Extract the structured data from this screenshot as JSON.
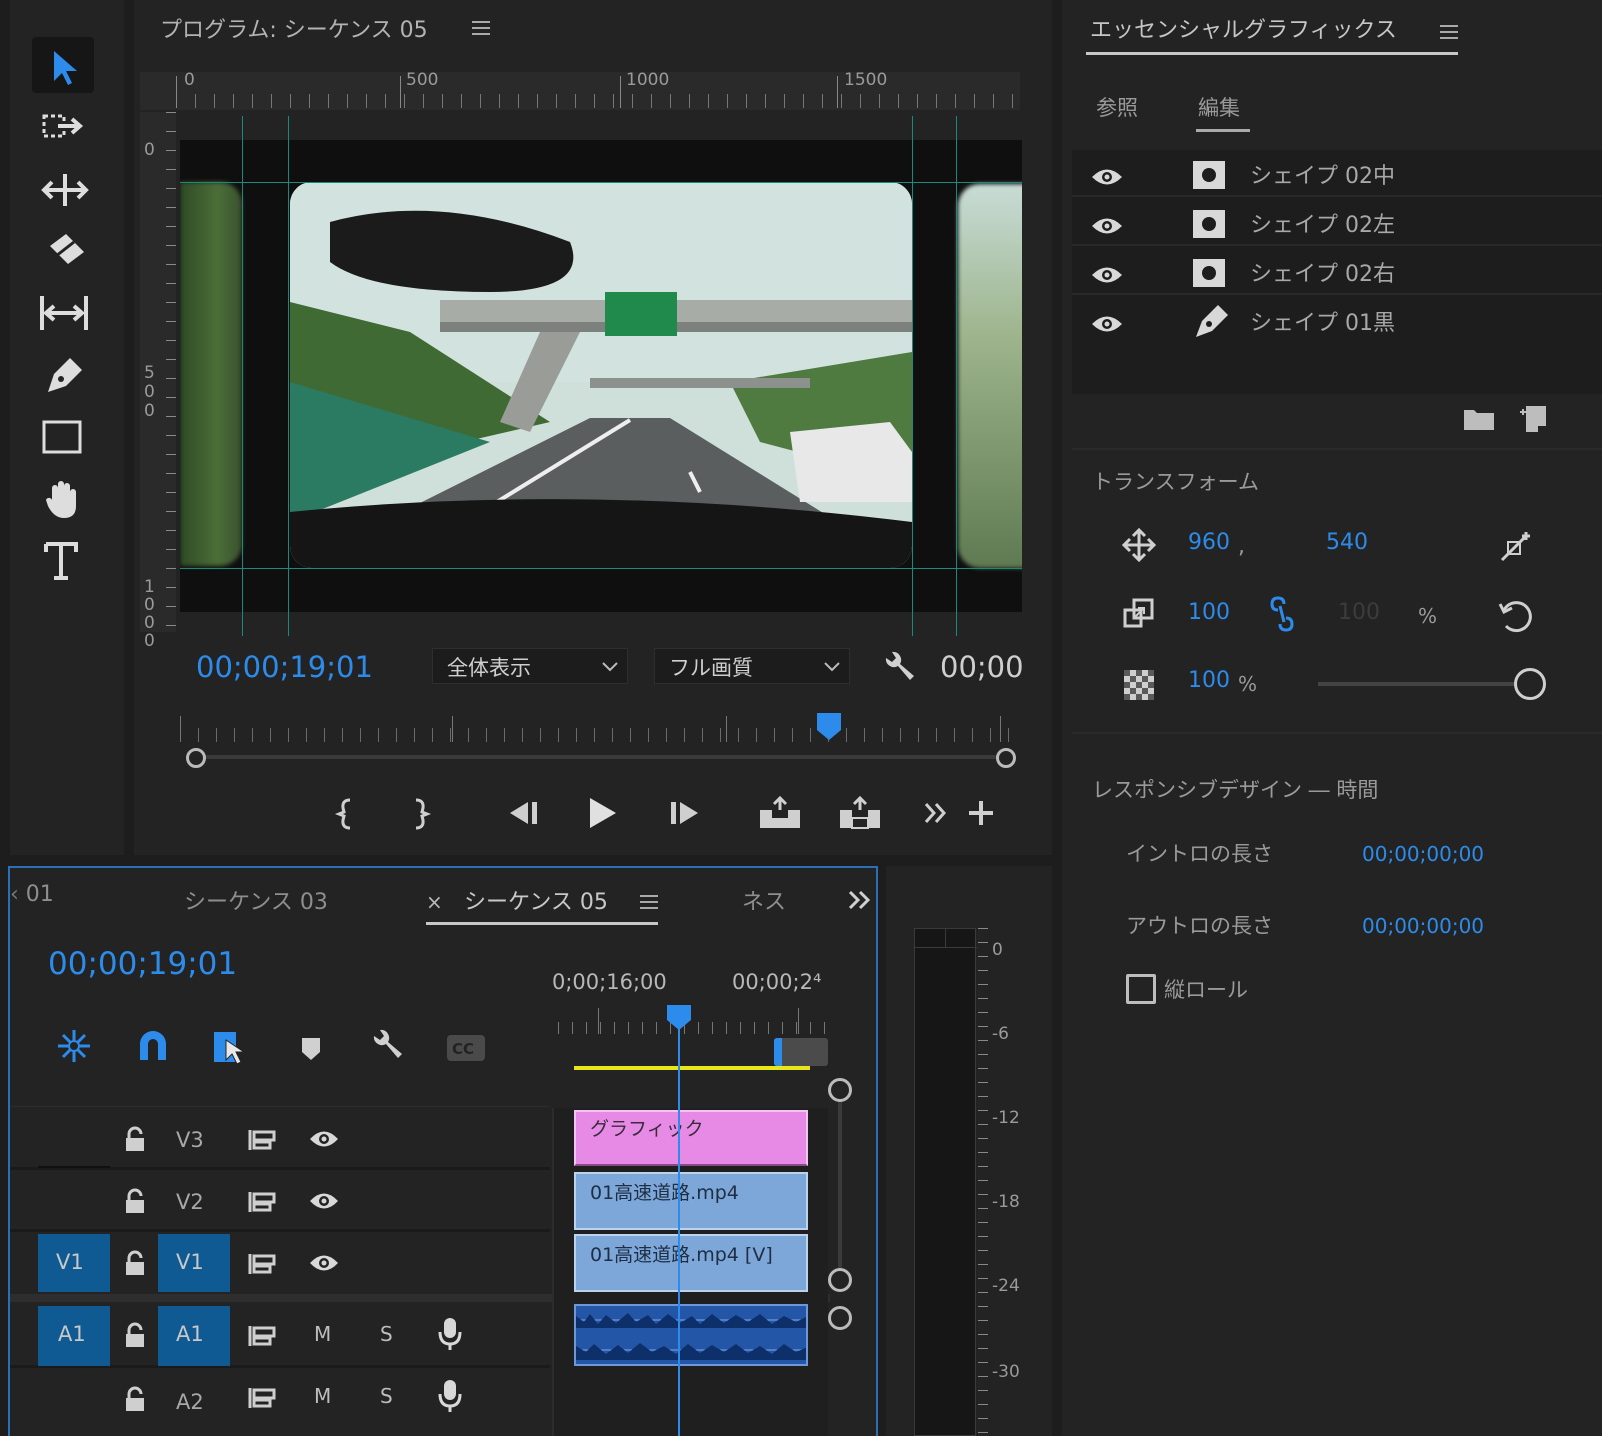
{
  "program": {
    "title": "プログラム: シーケンス 05",
    "ruler_top": [
      "0",
      "500",
      "1000",
      "1500"
    ],
    "ruler_left": [
      "0",
      "5\n0\n0",
      "1\n0\n0\n0"
    ],
    "timecode": "00;00;19;01",
    "zoom_select": "全体表示",
    "quality_select": "フル画質",
    "duration": "00;00"
  },
  "egraphics": {
    "title": "エッセンシャルグラフィックス",
    "tab_browse": "参照",
    "tab_edit": "編集",
    "layers": [
      {
        "name": "シェイプ 02中",
        "icon": "shape-icon"
      },
      {
        "name": "シェイプ 02左",
        "icon": "shape-icon"
      },
      {
        "name": "シェイプ 02右",
        "icon": "shape-icon"
      },
      {
        "name": "シェイプ 01黒",
        "icon": "pen-icon"
      }
    ],
    "transform_title": "トランスフォーム",
    "pos_x": "960",
    "pos_sep": ",",
    "pos_y": "540",
    "scale": "100",
    "scale_h": "100",
    "scale_unit": "%",
    "opacity": "100",
    "opacity_unit": "%",
    "responsive_title": "レスポンシブデザイン ― 時間",
    "intro_label": "イントロの長さ",
    "intro_value": "00;00;00;00",
    "outro_label": "アウトロの長さ",
    "outro_value": "00;00;00;00",
    "roll_label": "縦ロール"
  },
  "timeline": {
    "tabs": [
      "01",
      "シーケンス 03",
      "シーケンス 05",
      "ネス"
    ],
    "close": "×",
    "overflow": "»",
    "timecode": "00;00;19;01",
    "ruler": [
      "0;00;16;00",
      "00;00;2⁴"
    ],
    "tracks": [
      {
        "src": "",
        "lock": "lock-icon",
        "name": "V3"
      },
      {
        "src": "",
        "lock": "lock-icon",
        "name": "V2"
      },
      {
        "src": "V1",
        "lock": "lock-icon",
        "name": "V1"
      },
      {
        "src": "A1",
        "lock": "lock-icon",
        "name": "A1",
        "m": "M",
        "s": "S"
      },
      {
        "src": "",
        "lock": "lock-icon",
        "name": "A2",
        "m": "M",
        "s": "S"
      }
    ],
    "clips": {
      "graphic": "グラフィック",
      "v2": "01高速道路.mp4",
      "v1": "01高速道路.mp4 [V]"
    }
  },
  "meter": {
    "labels": [
      "0",
      "-6",
      "-12",
      "-18",
      "-24",
      "-30"
    ]
  },
  "colors": {
    "accent": "#2d8ceb",
    "graphic_clip": "#e68ae6",
    "video_clip": "#7ea7d9",
    "audio_clip": "#2456a8",
    "track_target": "#0f5a92",
    "work_area": "#e6e619"
  }
}
